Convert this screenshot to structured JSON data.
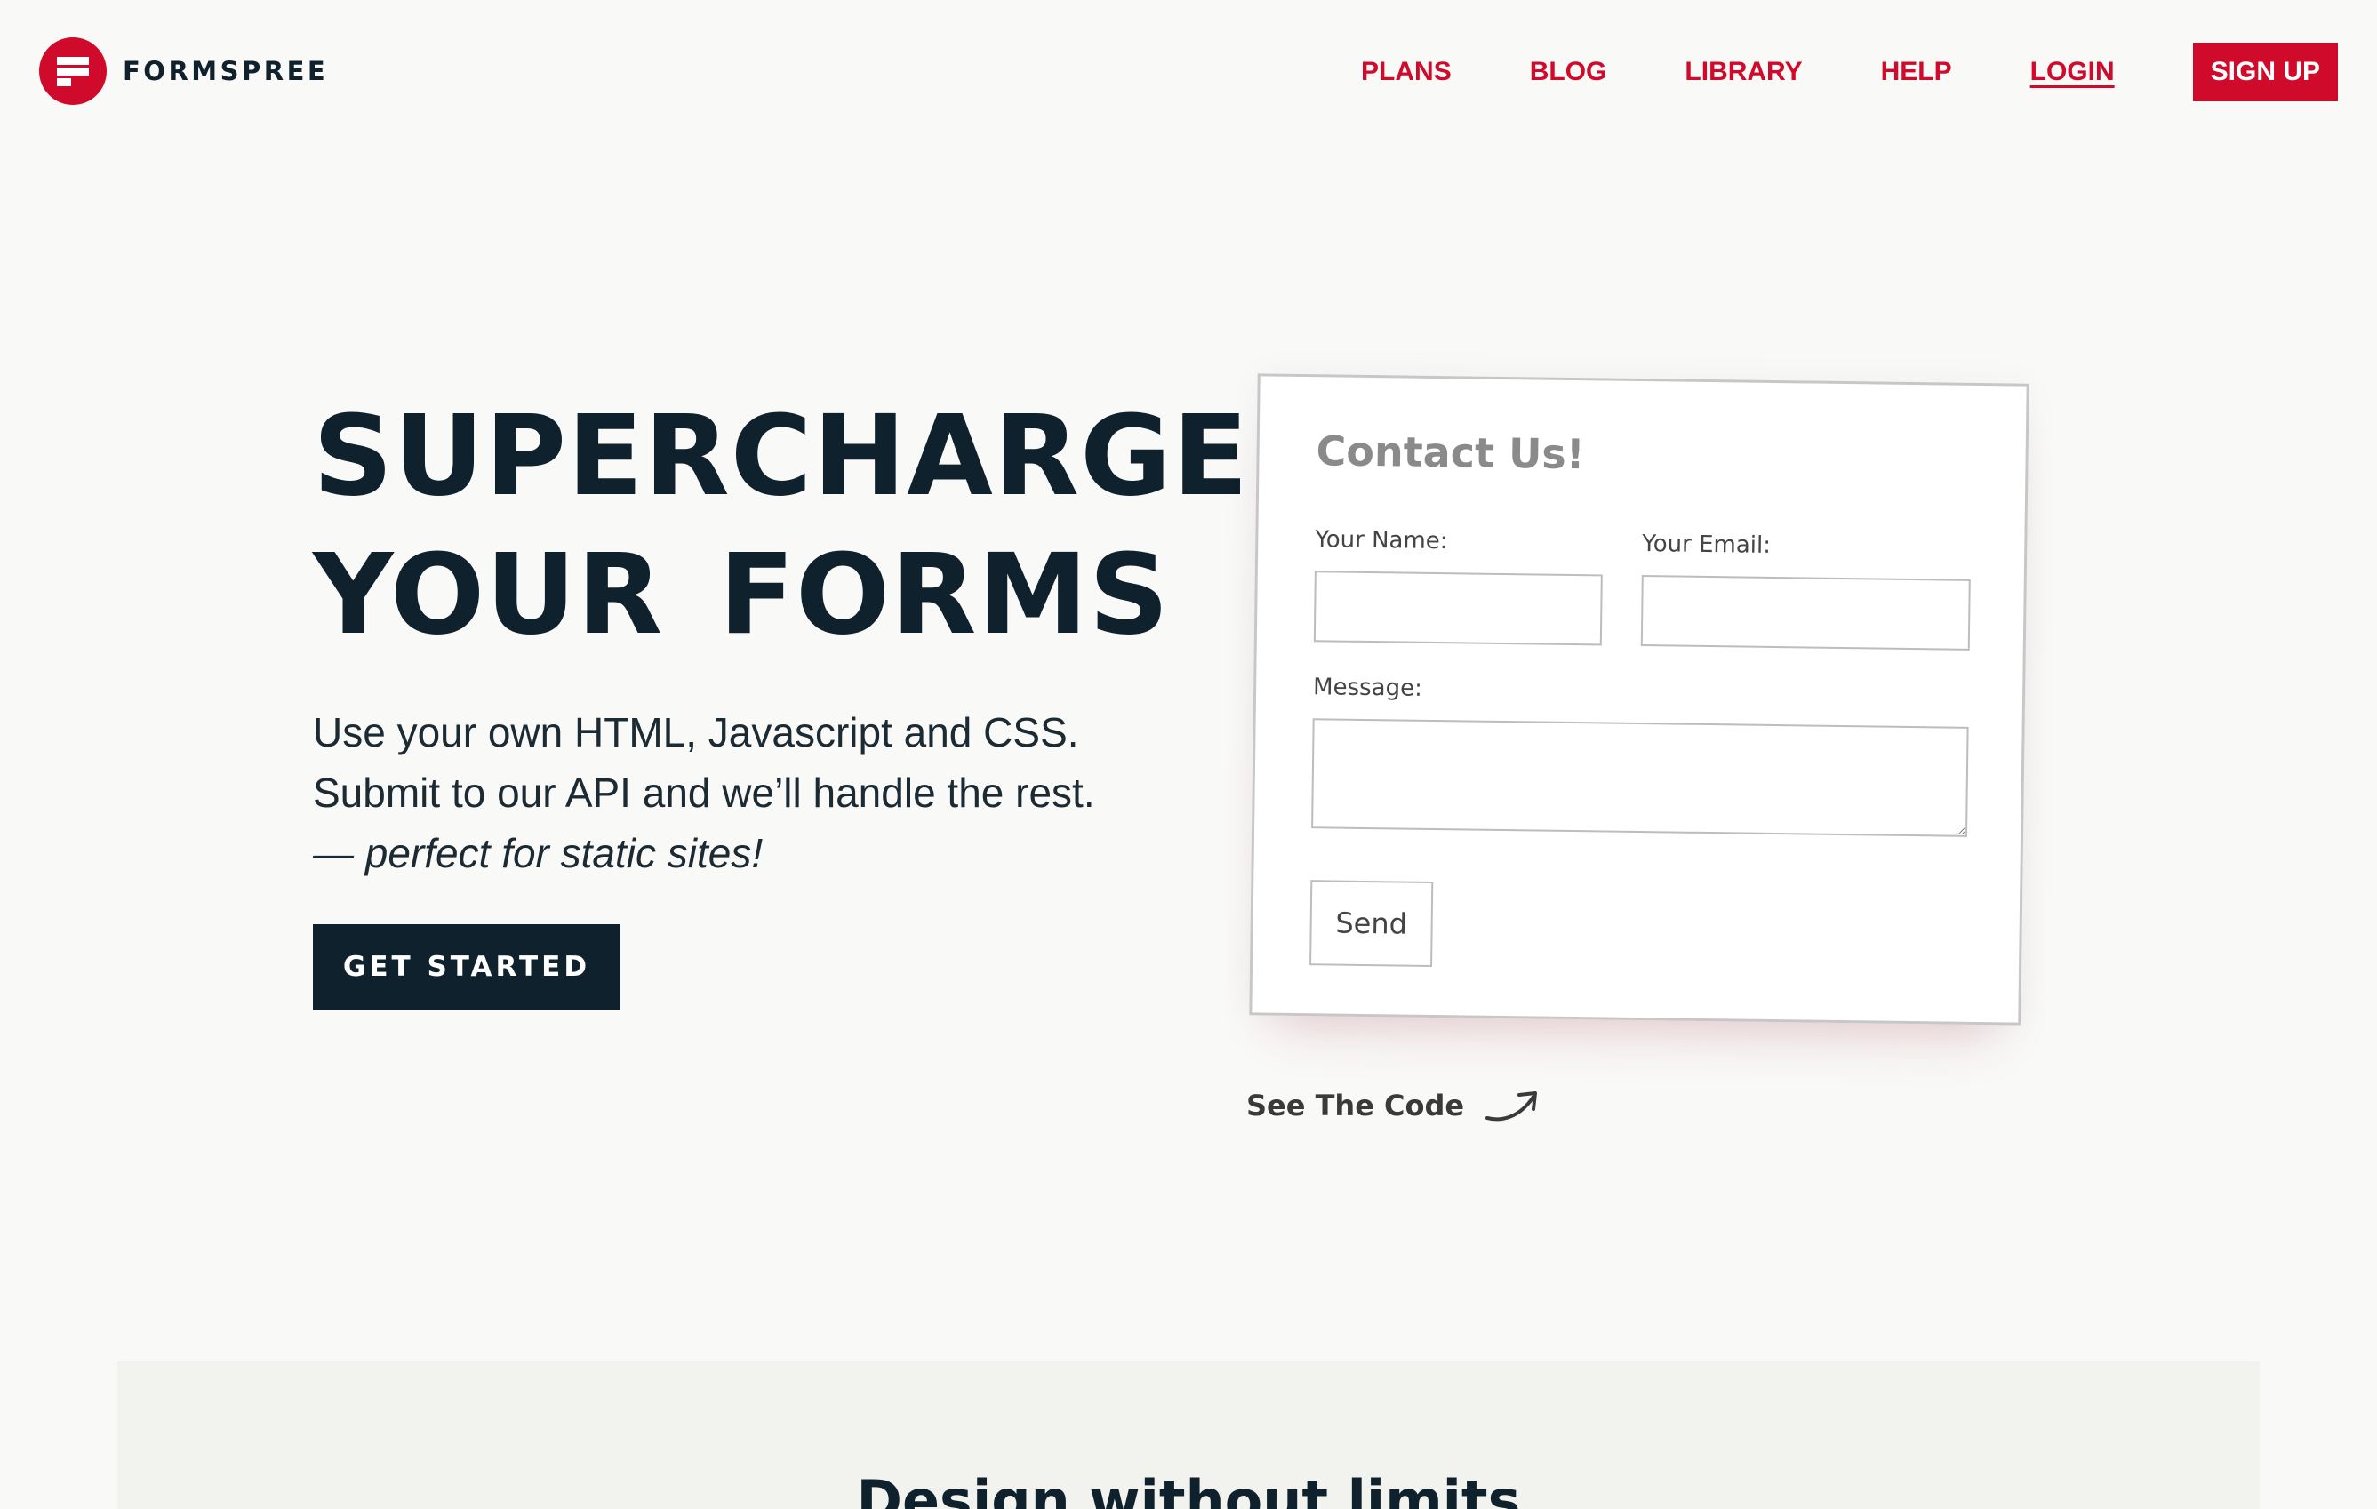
{
  "brand": {
    "name": "FORMSPREE",
    "color": "#cf0a2b",
    "dark": "#0f212c"
  },
  "nav": {
    "items": [
      "PLANS",
      "BLOG",
      "LIBRARY",
      "HELP"
    ],
    "login": "LOGIN",
    "signup": "SIGN UP"
  },
  "hero": {
    "title_line1": "SUPERCHARGE",
    "title_line2": "YOUR  FORMS",
    "sub_line1": "Use your own HTML, Javascript and CSS.",
    "sub_line2": "Submit to our API and we’ll handle the rest.",
    "sub_line3": "— perfect for static sites!",
    "cta": "GET STARTED"
  },
  "demo_form": {
    "title": "Contact Us!",
    "name_label": "Your Name:",
    "email_label": "Your Email:",
    "message_label": "Message:",
    "name_value": "",
    "email_value": "",
    "message_value": "",
    "send": "Send"
  },
  "see_code": {
    "label": "See The Code",
    "icon": "curved-arrow-icon"
  },
  "section": {
    "title": "Design without limits"
  }
}
